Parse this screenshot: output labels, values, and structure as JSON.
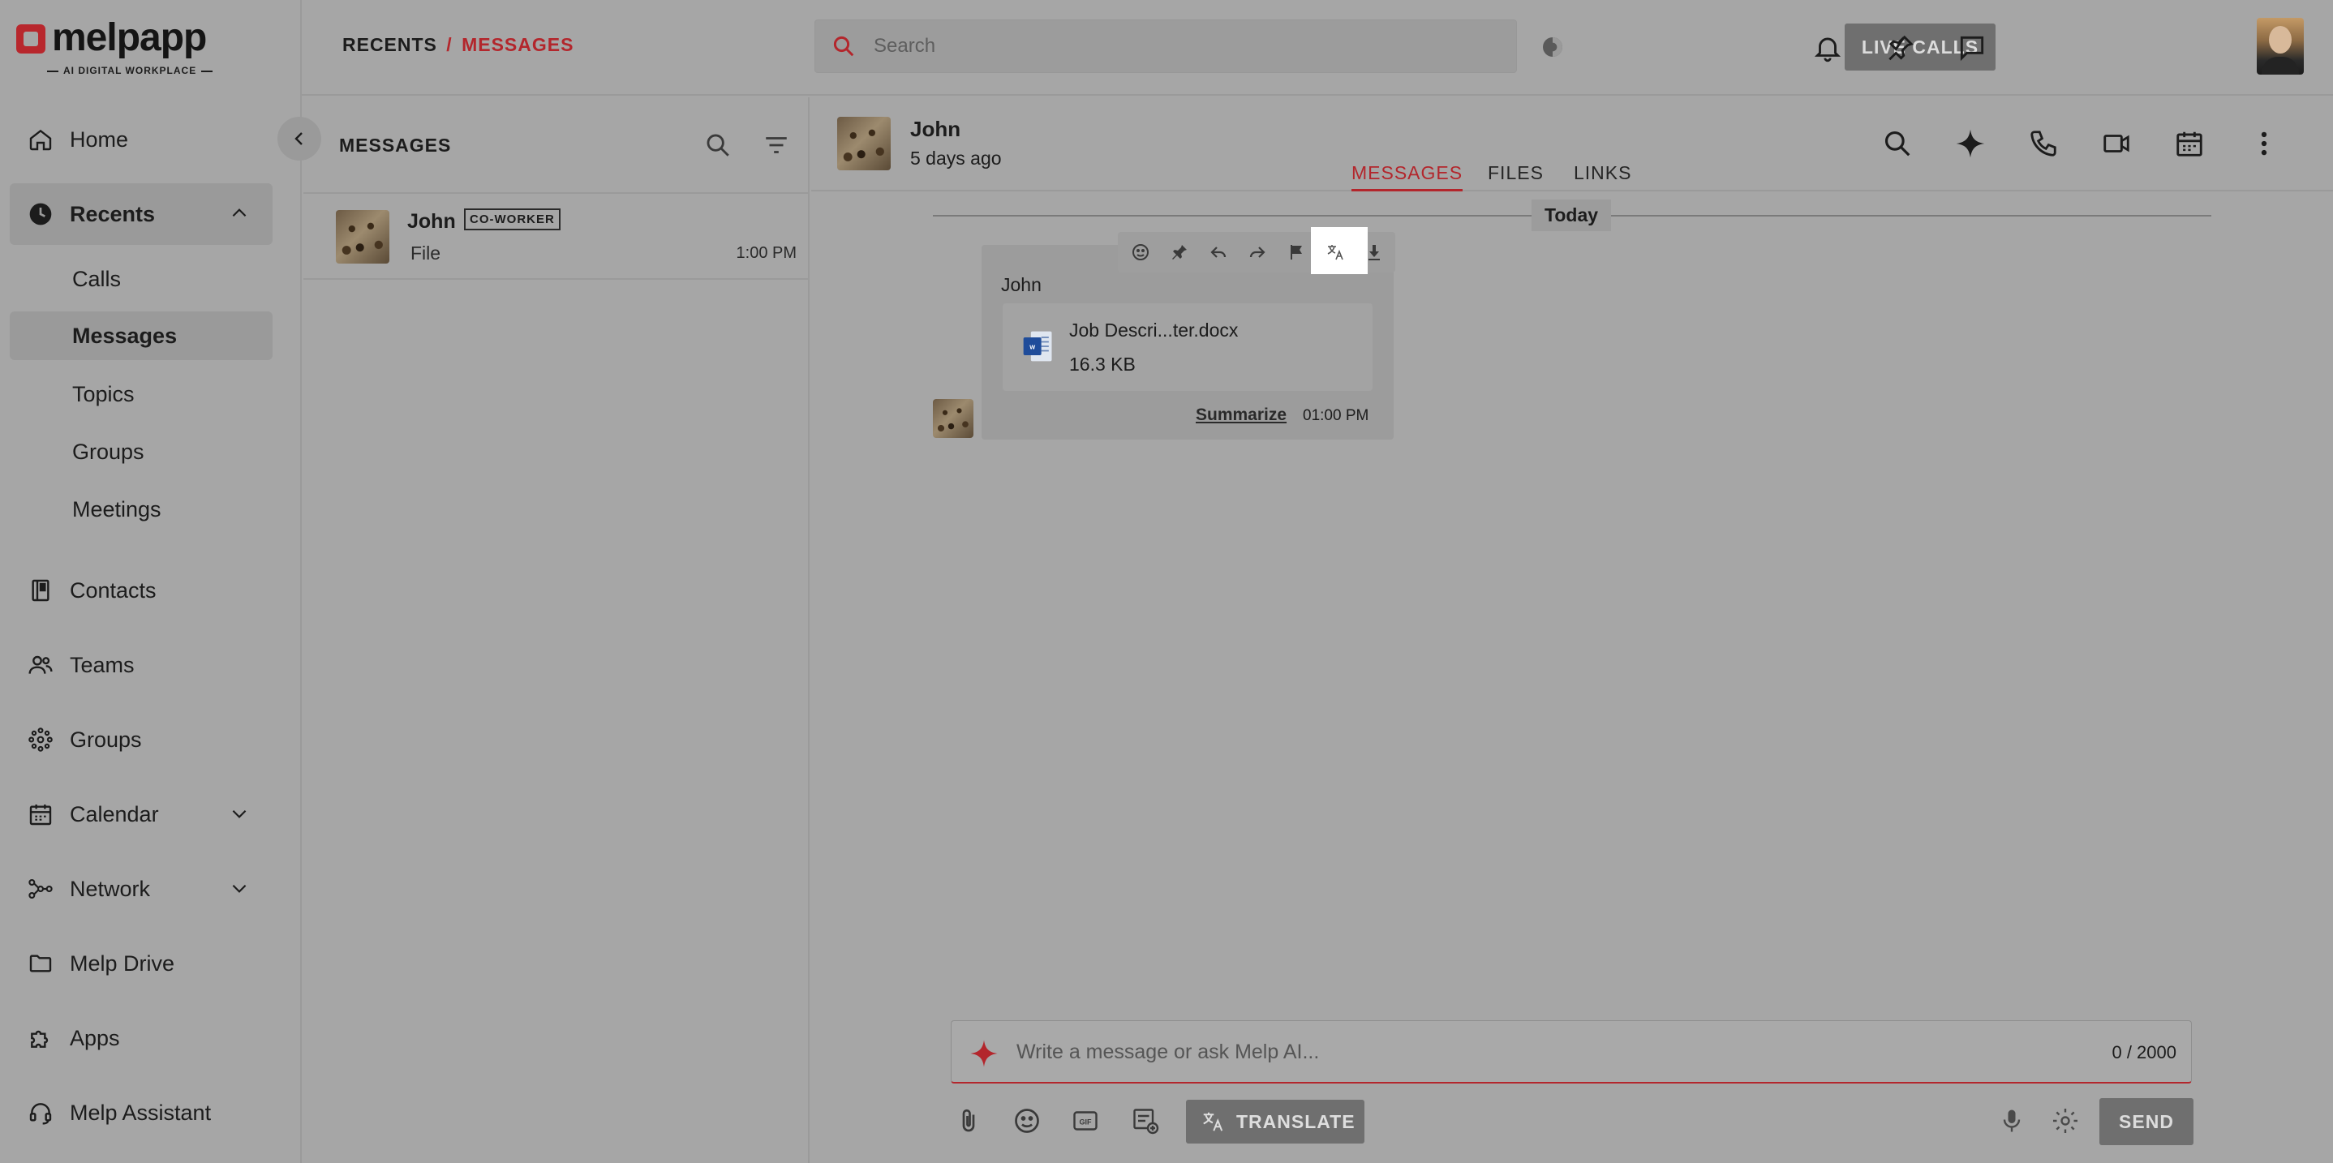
{
  "app": {
    "logo_text": "melpapp",
    "logo_subtitle": "AI DIGITAL WORKPLACE"
  },
  "sidebar": {
    "items": [
      {
        "label": "Home",
        "icon": "home-icon"
      },
      {
        "label": "Recents",
        "icon": "clock-icon",
        "active": true,
        "expanded": true
      },
      {
        "label": "Contacts",
        "icon": "contact-book-icon"
      },
      {
        "label": "Teams",
        "icon": "people-icon"
      },
      {
        "label": "Groups",
        "icon": "groups-icon"
      },
      {
        "label": "Calendar",
        "icon": "calendar-icon"
      },
      {
        "label": "Network",
        "icon": "network-icon"
      },
      {
        "label": "Melp Drive",
        "icon": "folder-icon"
      },
      {
        "label": "Apps",
        "icon": "puzzle-icon"
      },
      {
        "label": "Melp Assistant",
        "icon": "headset-icon"
      }
    ],
    "recents_sub": [
      {
        "label": "Calls"
      },
      {
        "label": "Messages",
        "active": true
      },
      {
        "label": "Topics"
      },
      {
        "label": "Groups"
      },
      {
        "label": "Meetings"
      }
    ]
  },
  "header": {
    "breadcrumb_root": "RECENTS",
    "breadcrumb_sep": "/",
    "breadcrumb_current": "MESSAGES",
    "search_placeholder": "Search",
    "live_calls_label": "LIVE CALLS"
  },
  "list": {
    "title": "MESSAGES",
    "rows": [
      {
        "name": "John",
        "badge": "CO-WORKER",
        "preview": "File",
        "time": "1:00 PM"
      }
    ]
  },
  "conversation": {
    "name": "John",
    "status": "5 days ago",
    "tabs": [
      {
        "label": "MESSAGES",
        "active": true
      },
      {
        "label": "FILES"
      },
      {
        "label": "LINKS"
      }
    ],
    "day_label": "Today",
    "message": {
      "sender": "John",
      "file_name": "Job Descri...ter.docx",
      "file_size": "16.3 KB",
      "summarize_label": "Summarize",
      "time": "01:00 PM"
    },
    "composer": {
      "placeholder": "Write a message or ask Melp AI...",
      "counter": "0 / 2000",
      "translate_label": "TRANSLATE",
      "send_label": "SEND"
    }
  },
  "colors": {
    "accent": "#b3262c",
    "overlay_gray": "#a6a6a6",
    "button_gray": "#6f6f6f"
  }
}
